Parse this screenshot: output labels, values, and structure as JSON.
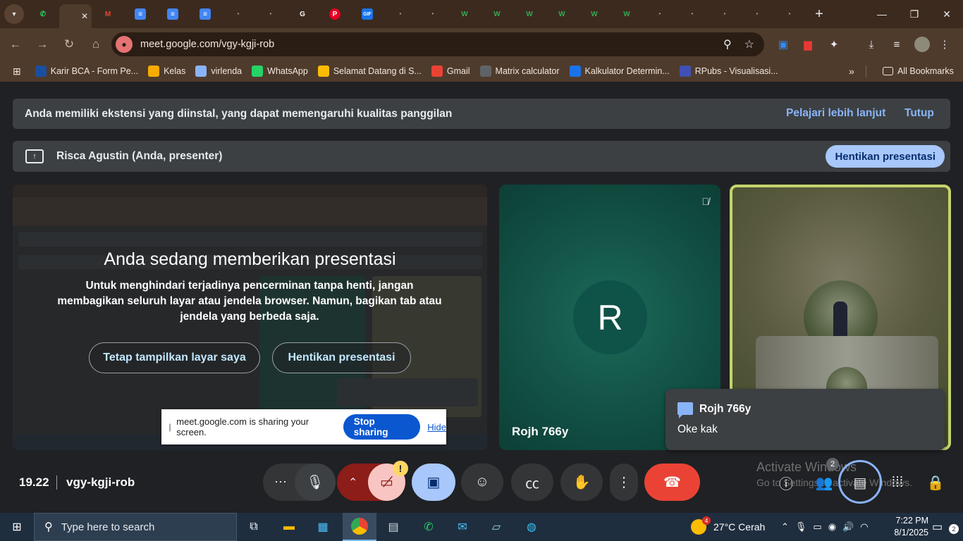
{
  "browser": {
    "tabs": [
      {
        "icon": "whatsapp-icon",
        "color": "#25d366",
        "glyph": "✆",
        "active": false
      },
      {
        "icon": "meet-icon",
        "color": "#e8eaed",
        "glyph": "",
        "active": true,
        "close": "✕"
      },
      {
        "icon": "gmail-icon",
        "color": "#ea4335",
        "glyph": "M",
        "active": false
      },
      {
        "icon": "docs-icon",
        "color": "#4285f4",
        "glyph": "≡",
        "active": false
      },
      {
        "icon": "docs-icon",
        "color": "#4285f4",
        "glyph": "≡",
        "active": false
      },
      {
        "icon": "docs-icon",
        "color": "#4285f4",
        "glyph": "≡",
        "active": false
      },
      {
        "icon": "globe-icon",
        "color": "#9aa0a6",
        "glyph": "◔",
        "active": false
      },
      {
        "icon": "globe-icon",
        "color": "#9aa0a6",
        "glyph": "◔",
        "active": false
      },
      {
        "icon": "google-icon",
        "color": "#ffffff",
        "glyph": "G",
        "active": false
      },
      {
        "icon": "pinterest-icon",
        "color": "#e60023",
        "glyph": "P",
        "active": false
      },
      {
        "icon": "gif-icon",
        "color": "#1a73e8",
        "glyph": "GIF",
        "active": false
      },
      {
        "icon": "globe-icon",
        "color": "#9aa0a6",
        "glyph": "◔",
        "active": false
      },
      {
        "icon": "globe-icon",
        "color": "#9aa0a6",
        "glyph": "◔",
        "active": false
      },
      {
        "icon": "w-icon",
        "color": "#34a853",
        "glyph": "W",
        "active": false
      },
      {
        "icon": "w-icon",
        "color": "#34a853",
        "glyph": "W",
        "active": false
      },
      {
        "icon": "w-icon",
        "color": "#34a853",
        "glyph": "W",
        "active": false
      },
      {
        "icon": "w-icon",
        "color": "#34a853",
        "glyph": "W",
        "active": false
      },
      {
        "icon": "w-icon",
        "color": "#34a853",
        "glyph": "W",
        "active": false
      },
      {
        "icon": "w-icon",
        "color": "#34a853",
        "glyph": "W",
        "active": false
      },
      {
        "icon": "globe-icon",
        "color": "#9aa0a6",
        "glyph": "◔",
        "active": false
      },
      {
        "icon": "globe-icon",
        "color": "#9aa0a6",
        "glyph": "◔",
        "active": false
      },
      {
        "icon": "globe-icon",
        "color": "#9aa0a6",
        "glyph": "◔",
        "active": false
      },
      {
        "icon": "globe-icon",
        "color": "#9aa0a6",
        "glyph": "◔",
        "active": false
      },
      {
        "icon": "globe-icon",
        "color": "#9aa0a6",
        "glyph": "◔",
        "active": false
      }
    ],
    "url": "meet.google.com/vgy-kgji-rob",
    "bookmarks": [
      {
        "label": "Karir BCA - Form Pe...",
        "icon": "bca-icon",
        "color": "#1a4fa0"
      },
      {
        "label": "Kelas",
        "icon": "classroom-icon",
        "color": "#f9ab00"
      },
      {
        "label": "virlenda",
        "icon": "bookmark-icon",
        "color": "#8ab4f8"
      },
      {
        "label": "WhatsApp",
        "icon": "whatsapp-icon",
        "color": "#25d366"
      },
      {
        "label": "Selamat Datang di S...",
        "icon": "university-icon",
        "color": "#fbbc04"
      },
      {
        "label": "Gmail",
        "icon": "gmail-icon",
        "color": "#ea4335"
      },
      {
        "label": "Matrix calculator",
        "icon": "calculator-icon",
        "color": "#5f6368"
      },
      {
        "label": "Kalkulator Determin...",
        "icon": "k-icon",
        "color": "#1a73e8"
      },
      {
        "label": "RPubs - Visualisasi...",
        "icon": "rpubs-icon",
        "color": "#3f51b5"
      }
    ],
    "all_bookmarks": "All Bookmarks"
  },
  "meet": {
    "notice": {
      "text": "Anda memiliki ekstensi yang diinstal, yang dapat memengaruhi kualitas panggilan",
      "learn_more": "Pelajari lebih lanjut",
      "close": "Tutup"
    },
    "presenter": {
      "name": "Risca Agustin (Anda, presenter)",
      "stop_label": "Hentikan presentasi"
    },
    "presenting": {
      "title": "Anda sedang memberikan presentasi",
      "body": "Untuk menghindari terjadinya pencerminan tanpa henti, jangan membagikan seluruh layar atau jendela browser. Namun, bagikan tab atau jendela yang berbeda saja.",
      "keep_label": "Tetap tampilkan layar saya",
      "stop_label": "Hentikan presentasi"
    },
    "share_bar": {
      "text": "meet.google.com is sharing your screen.",
      "stop": "Stop sharing",
      "hide": "Hide"
    },
    "participant": {
      "initial": "R",
      "name": "Rojh 766y"
    },
    "chat": {
      "sender": "Rojh 766y",
      "message": "Oke kak"
    },
    "meeting": {
      "time": "19.22",
      "code": "vgy-kgji-rob"
    },
    "controls": {
      "warning": "!",
      "people_count": "2",
      "colors": {
        "end_call": "#ea4335",
        "present_active": "#a8c7fa",
        "camera_off": "#f9c5c2",
        "mic_more_red": "#8c1d18"
      }
    },
    "watermark": {
      "title": "Activate Windows",
      "sub": "Go to Settings to activate Windows."
    }
  },
  "taskbar": {
    "search_placeholder": "Type here to search",
    "weather": "27°C  Cerah",
    "weather_badge": "4",
    "time": "7:22 PM",
    "date": "8/1/2025",
    "notifications": "2"
  }
}
